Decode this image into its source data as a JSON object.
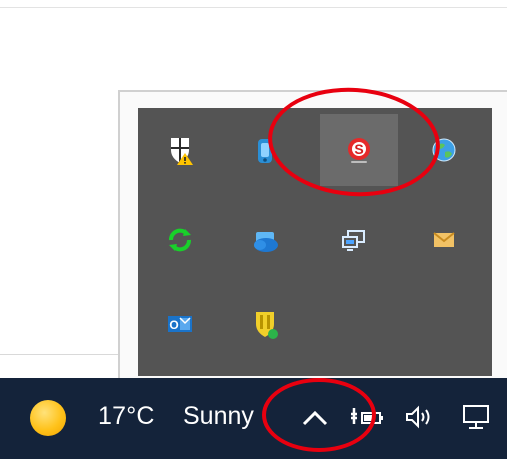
{
  "taskbar": {
    "weather_temp": "17°C",
    "weather_condition": "Sunny",
    "weather_icon": "sun-icon",
    "show_hidden_icon": "chevron-up-icon",
    "network_icon": "network-battery-icon",
    "volume_icon": "speaker-icon",
    "display_icon": "monitor-icon"
  },
  "tray_flyout": {
    "icons": [
      {
        "name": "security-shield-warning-icon"
      },
      {
        "name": "network-sync-icon"
      },
      {
        "name": "s-app-icon"
      },
      {
        "name": "globe-icon"
      },
      {
        "name": "green-sync-icon"
      },
      {
        "name": "cloud-drive-icon"
      },
      {
        "name": "remote-display-icon"
      },
      {
        "name": "mail-envelope-icon"
      },
      {
        "name": "outlook-icon"
      },
      {
        "name": "yellow-shield-icon"
      }
    ]
  },
  "annotations": {
    "ring_color": "#e8000f"
  }
}
